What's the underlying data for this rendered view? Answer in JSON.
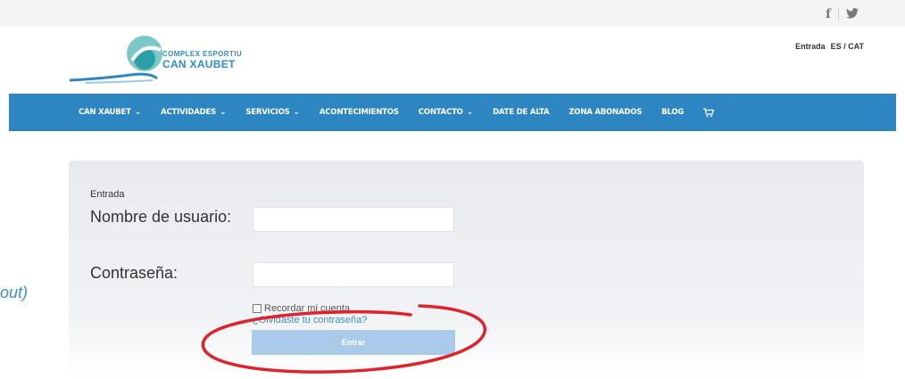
{
  "social": {
    "facebook": "f",
    "twitter": "🐦"
  },
  "header": {
    "logo_line1": "COMPLEX ESPORTIU",
    "logo_line2": "CAN XAUBET",
    "entrada_link": "Entrada",
    "lang_link": "ES / CAT"
  },
  "nav": {
    "items": [
      {
        "label": "CAN XAUBET",
        "chevron": "⌄"
      },
      {
        "label": "ACTIVIDADES",
        "chevron": "⌄"
      },
      {
        "label": "SERVICIOS",
        "chevron": "⌄"
      },
      {
        "label": "ACONTECIMIENTOS"
      },
      {
        "label": "CONTACTO",
        "chevron": "⌄"
      },
      {
        "label": "DATE DE ALTA"
      },
      {
        "label": "ZONA ABONADOS"
      },
      {
        "label": "BLOG"
      }
    ],
    "cart_icon": "🛒"
  },
  "login": {
    "title": "Entrada",
    "username_label": "Nombre de usuario:",
    "username_value": "",
    "password_label": "Contraseña:",
    "password_value": "",
    "remember_label": "Recordar mi cuenta",
    "forgot_link": "¿Olvidaste tu contraseña?",
    "submit_label": "Entrar"
  },
  "side_fragment": "out)",
  "colors": {
    "nav_bg": "#2d86c2",
    "button_bg": "#a9cbe9",
    "annotation": "#e0232a"
  }
}
